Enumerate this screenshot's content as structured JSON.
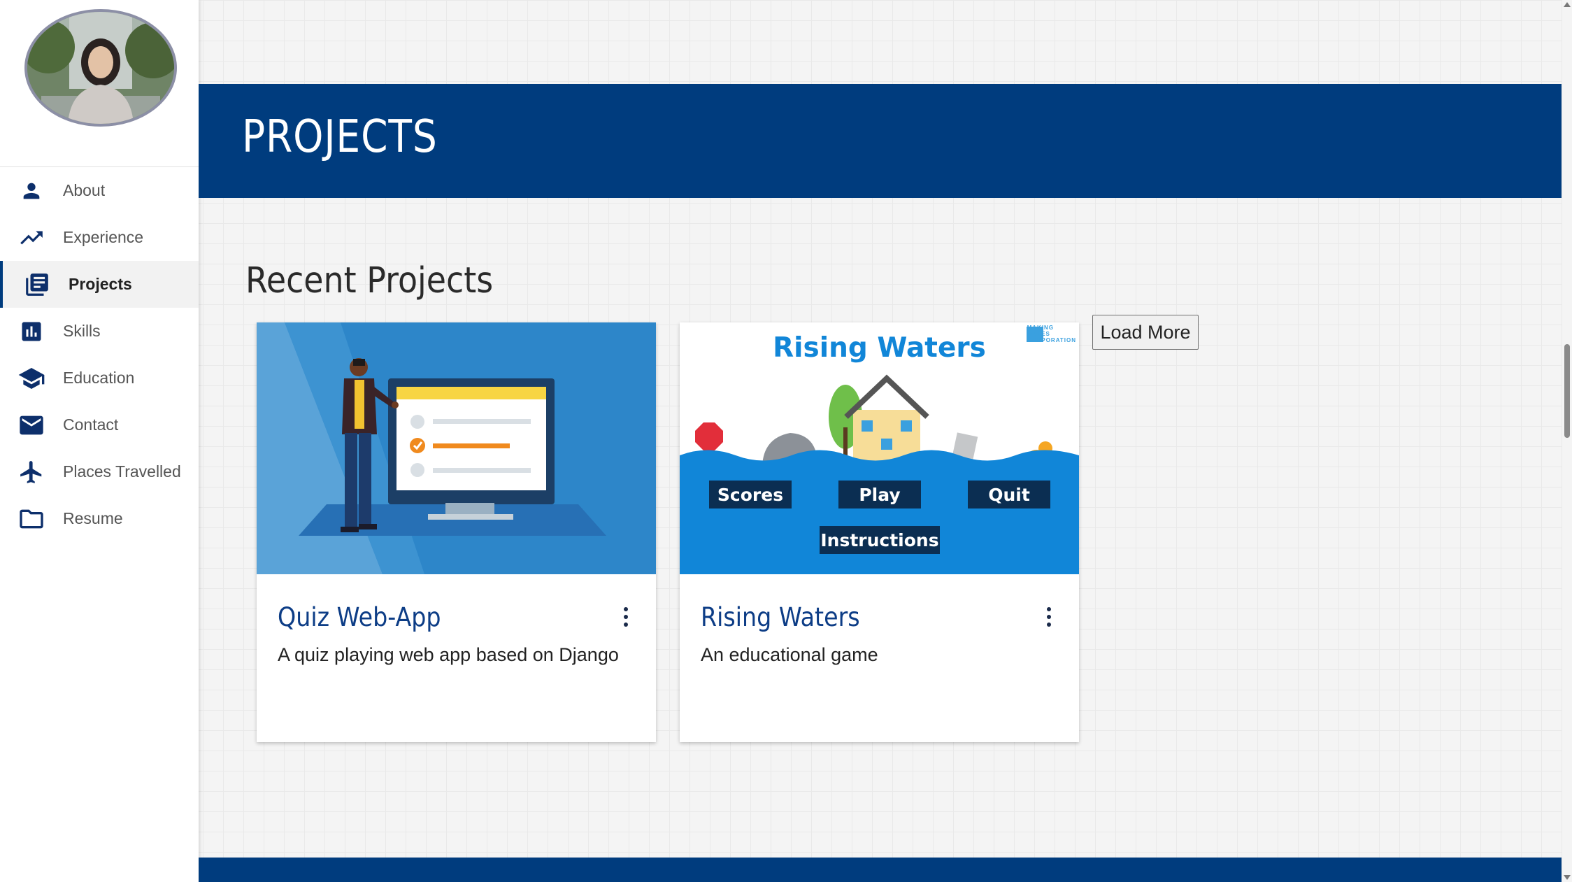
{
  "sidebar": {
    "avatar_alt": "profile photo",
    "items": [
      {
        "label": "About",
        "icon": "person-icon",
        "active": false
      },
      {
        "label": "Experience",
        "icon": "trending-up-icon",
        "active": false
      },
      {
        "label": "Projects",
        "icon": "library-books-icon",
        "active": true
      },
      {
        "label": "Skills",
        "icon": "bar-chart-icon",
        "active": false
      },
      {
        "label": "Education",
        "icon": "graduation-cap-icon",
        "active": false
      },
      {
        "label": "Contact",
        "icon": "mail-icon",
        "active": false
      },
      {
        "label": "Places Travelled",
        "icon": "airplane-icon",
        "active": false
      },
      {
        "label": "Resume",
        "icon": "folder-icon",
        "active": false
      }
    ]
  },
  "banner": {
    "title": "PROJECTS"
  },
  "main": {
    "section_title": "Recent Projects",
    "load_more_label": "Load More",
    "cards": [
      {
        "title": "Quiz Web-App",
        "description": "A quiz playing web app based on Django",
        "image": "quiz-illustration"
      },
      {
        "title": "Rising Waters",
        "description": "An educational game",
        "image": "rising-waters-game-screen",
        "image_text": {
          "heading": "Rising Waters",
          "logo": [
            "MAKING",
            "WAVES",
            "CORPORATION"
          ],
          "buttons": [
            "Scores",
            "Play",
            "Quit",
            "Instructions"
          ]
        }
      }
    ]
  },
  "colors": {
    "primary": "#003c7e",
    "card_title": "#0d3d86",
    "rising_waters_blue": "#1186d8",
    "quiz_bg": "#2d86c9"
  }
}
